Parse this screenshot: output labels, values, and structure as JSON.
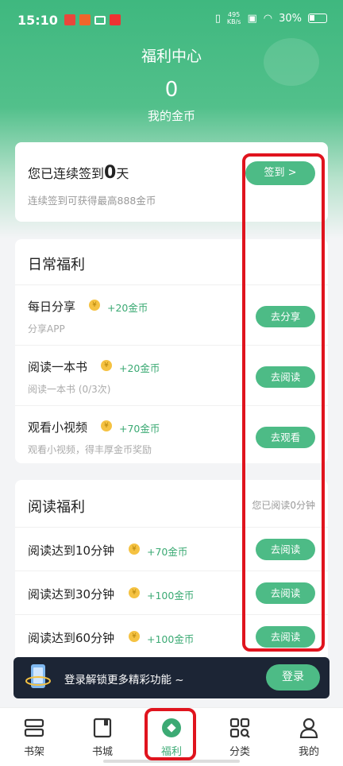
{
  "status_bar": {
    "time": "15:10",
    "speed_top": "495",
    "speed_bottom": "KB/s",
    "battery": "30%"
  },
  "header": {
    "title": "福利中心",
    "coins_value": "0",
    "coins_label": "我的金币"
  },
  "checkin": {
    "prefix": "您已连续签到",
    "days": "0",
    "suffix": "天",
    "subtitle": "连续签到可获得最高888金币",
    "button": "签到 >"
  },
  "daily": {
    "title": "日常福利",
    "tasks": [
      {
        "name": "每日分享",
        "reward": "+20金币",
        "desc": "分享APP",
        "action": "去分享"
      },
      {
        "name": "阅读一本书",
        "reward": "+20金币",
        "desc": "阅读一本书 (0/3次)",
        "action": "去阅读"
      },
      {
        "name": "观看小视频",
        "reward": "+70金币",
        "desc": "观看小视频，得丰厚金币奖励",
        "action": "去观看"
      }
    ]
  },
  "reading": {
    "title": "阅读福利",
    "status": "您已阅读0分钟",
    "tasks": [
      {
        "name": "阅读达到10分钟",
        "reward": "+70金币",
        "action": "去阅读"
      },
      {
        "name": "阅读达到30分钟",
        "reward": "+100金币",
        "action": "去阅读"
      },
      {
        "name": "阅读达到60分钟",
        "reward": "+100金币",
        "action": "去阅读"
      }
    ]
  },
  "banner": {
    "text": "登录解锁更多精彩功能 ~",
    "button": "登录"
  },
  "tabs": [
    {
      "label": "书架",
      "icon": "bookshelf-icon"
    },
    {
      "label": "书城",
      "icon": "bookstore-icon"
    },
    {
      "label": "福利",
      "icon": "welfare-icon",
      "active": true
    },
    {
      "label": "分类",
      "icon": "category-icon"
    },
    {
      "label": "我的",
      "icon": "profile-icon"
    }
  ],
  "coin_glyph": "¥",
  "colors": {
    "accent": "#4dbb86",
    "reward_text": "#3caa74",
    "annotation": "#e0141e",
    "banner_bg": "#1c2535"
  }
}
